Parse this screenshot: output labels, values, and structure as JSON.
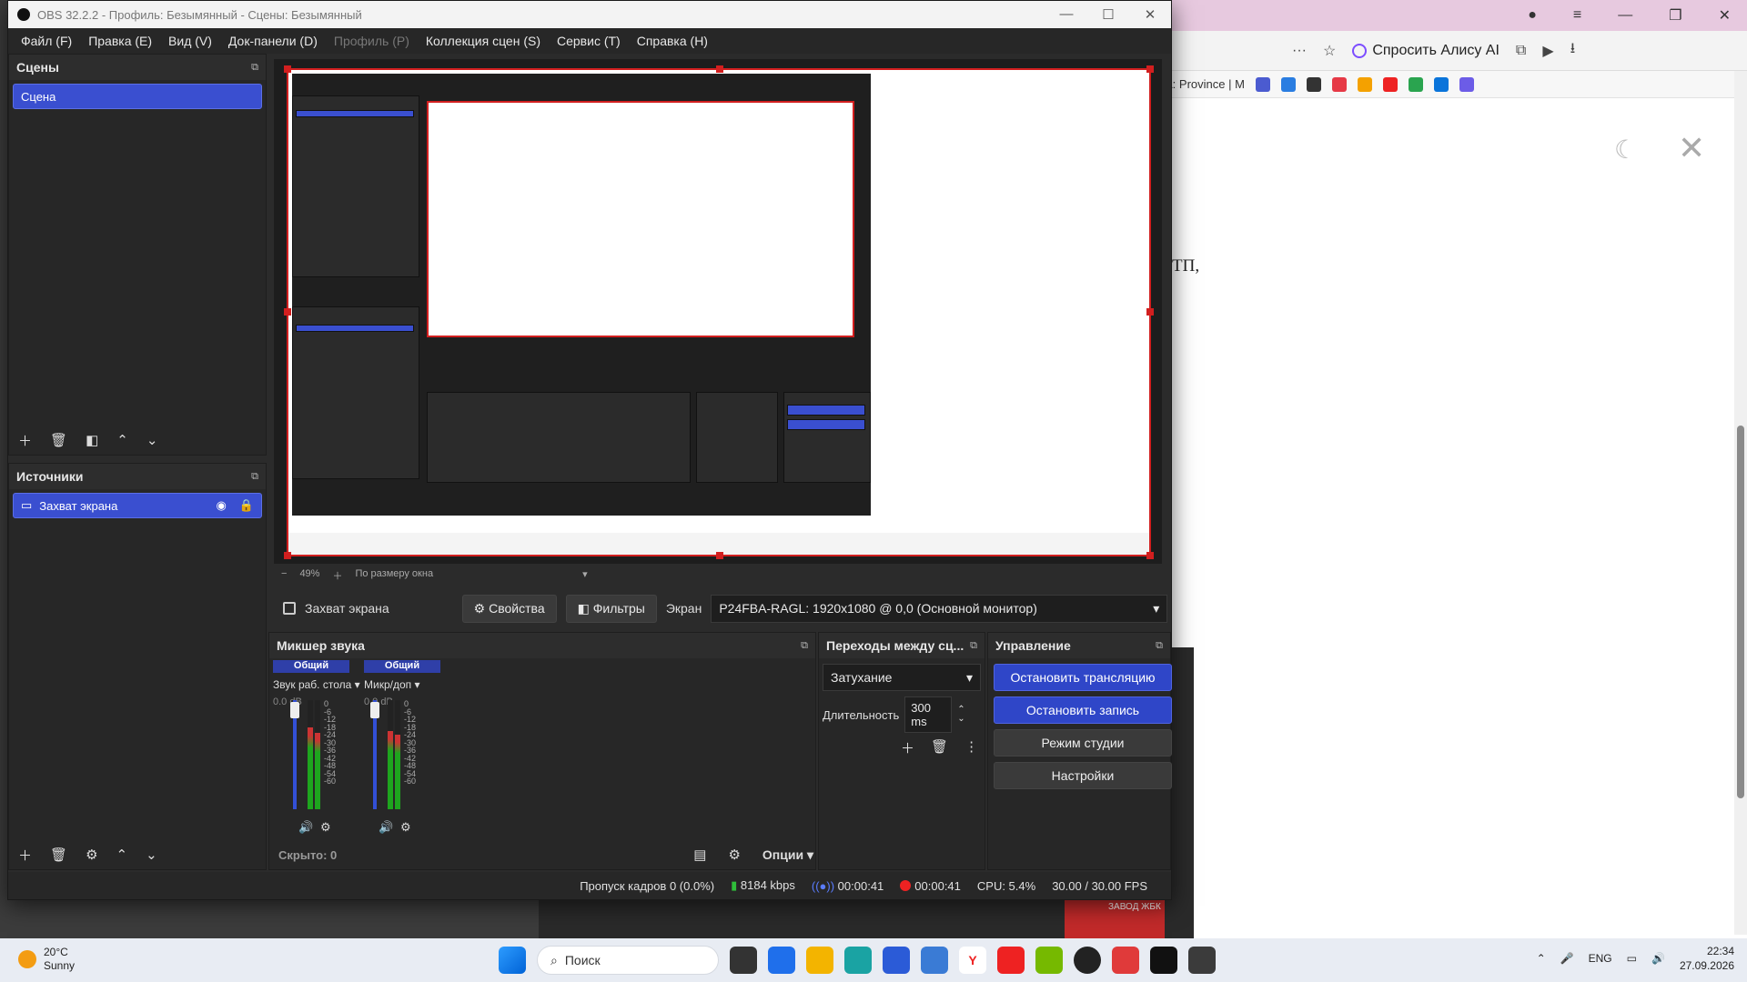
{
  "window": {
    "title": "OBS 32.2.2 - Профиль: Безымянный - Сцены: Безымянный",
    "min": "—",
    "max": "☐",
    "close": "✕"
  },
  "menu": [
    "Файл (F)",
    "Правка (E)",
    "Вид (V)",
    "Док-панели (D)",
    "Профиль (P)",
    "Коллекция сцен (S)",
    "Сервис (T)",
    "Справка (H)"
  ],
  "scenes": {
    "title": "Сцены",
    "items": [
      "Сцена"
    ]
  },
  "sources": {
    "title": "Источники",
    "items": [
      "Захват экрана"
    ]
  },
  "preview": {
    "zoom": "49%",
    "fit": "По размеру окна"
  },
  "source_bar": {
    "name": "Захват экрана",
    "properties": "Свойства",
    "filters": "Фильтры",
    "screen_label": "Экран",
    "screen_value": "P24FBA-RAGL: 1920x1080 @ 0,0 (Основной монитор)"
  },
  "mixer": {
    "title": "Микшер звука",
    "channels": [
      {
        "header": "Общий",
        "name": "Звук раб. стола",
        "db": "0.0 dB"
      },
      {
        "header": "Общий",
        "name": "Микр/доп",
        "db": "0.0 dB"
      }
    ],
    "scale": [
      "0",
      "-6",
      "-12",
      "-18",
      "-24",
      "-30",
      "-36",
      "-42",
      "-48",
      "-54",
      "-60"
    ],
    "hidden": "Скрыто: 0",
    "options": "Опции"
  },
  "transitions": {
    "title": "Переходы между сц...",
    "selected": "Затухание",
    "duration_label": "Длительность",
    "duration_value": "300 ms"
  },
  "controls": {
    "title": "Управление",
    "stop_stream": "Остановить трансляцию",
    "stop_record": "Остановить запись",
    "studio": "Режим студии",
    "settings": "Настройки"
  },
  "status": {
    "dropped": "Пропуск кадров 0 (0.0%)",
    "bitrate": "8184 kbps",
    "stream_time": "00:00:41",
    "rec_time": "00:00:41",
    "cpu": "CPU: 5.4%",
    "fps": "30.00 / 30.00 FPS"
  },
  "browser": {
    "alice": "Спросить Алису AI",
    "bookmark_frag": "A: Province | М",
    "text_frag": "ТП,",
    "sign": "ЗАВОД ЖБК"
  },
  "taskbar": {
    "temp": "20°C",
    "weather": "Sunny",
    "search": "Поиск",
    "lang": "ENG",
    "time": "22:34",
    "date": "27.09.2026"
  },
  "colors": {
    "accent": "#3a4fd0",
    "record": "#e22222",
    "preview_border": "#d21f1f"
  }
}
